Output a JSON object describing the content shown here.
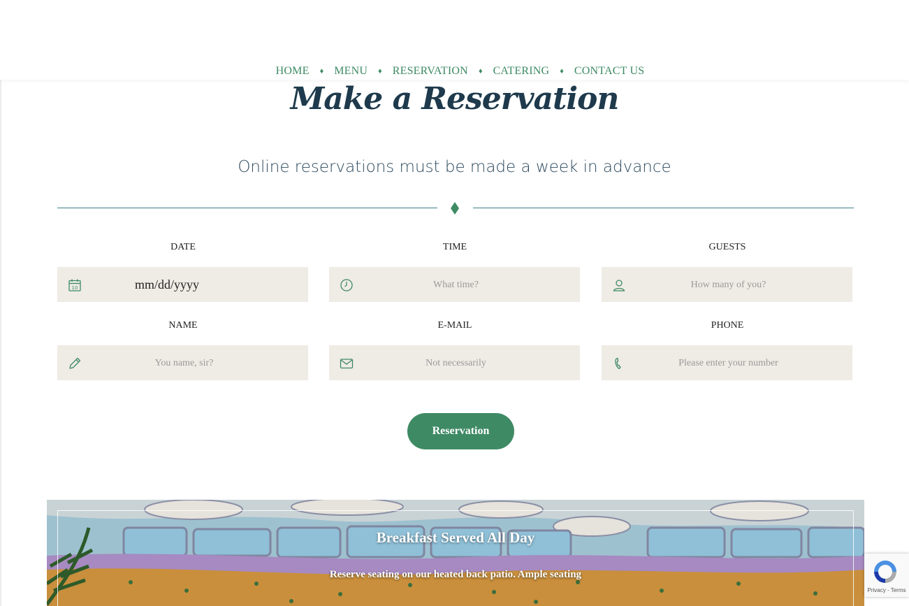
{
  "nav": {
    "items": [
      "HOME",
      "MENU",
      "RESERVATION",
      "CATERING",
      "CONTACT US"
    ],
    "separator": "♦"
  },
  "page": {
    "title": "Make a Reservation",
    "subtitle": "Online reservations must be made a week in advance"
  },
  "form": {
    "date": {
      "label": "DATE",
      "value": "mm/dd/yyyy",
      "icon": "calendar-icon"
    },
    "time": {
      "label": "TIME",
      "placeholder": "What time?",
      "icon": "clock-icon"
    },
    "guests": {
      "label": "GUESTS",
      "placeholder": "How many of you?",
      "icon": "user-icon"
    },
    "name": {
      "label": "NAME",
      "placeholder": "You name, sir?",
      "icon": "pencil-icon"
    },
    "email": {
      "label": "E-MAIL",
      "placeholder": "Not necessarily",
      "icon": "envelope-icon"
    },
    "phone": {
      "label": "PHONE",
      "placeholder": "Please enter your number",
      "icon": "phone-icon"
    },
    "submit_label": "Reservation"
  },
  "banner": {
    "title": "Breakfast Served All Day",
    "text": "Reserve seating on our heated back patio. Ample seating"
  },
  "recaptcha": {
    "links": "Privacy - Terms"
  },
  "colors": {
    "accent": "#3e8a64",
    "heading": "#1e3a4c",
    "field_bg": "#efebe5",
    "divider": "#3c7e8a"
  }
}
